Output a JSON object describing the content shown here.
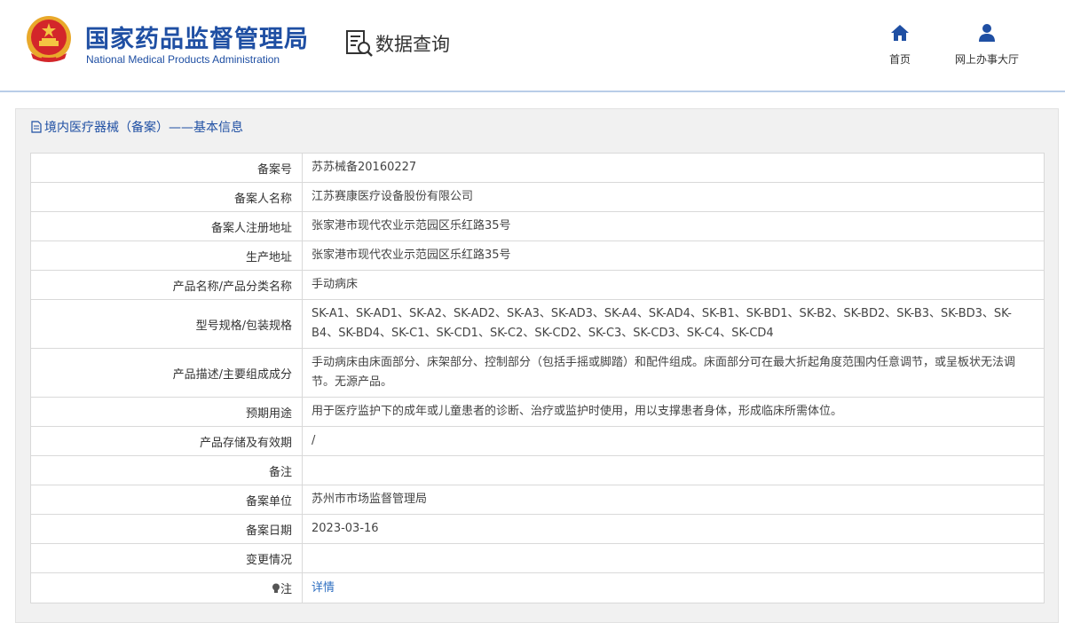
{
  "header": {
    "title_cn": "国家药品监督管理局",
    "title_en": "National Medical Products Administration",
    "query_label": "数据查询",
    "nav": {
      "home": "首页",
      "online_hall": "网上办事大厅"
    }
  },
  "section": {
    "title": "境内医疗器械（备案）——基本信息"
  },
  "rows": [
    {
      "label": "备案号",
      "value": "苏苏械备20160227"
    },
    {
      "label": "备案人名称",
      "value": "江苏赛康医疗设备股份有限公司"
    },
    {
      "label": "备案人注册地址",
      "value": "张家港市现代农业示范园区乐红路35号"
    },
    {
      "label": "生产地址",
      "value": "张家港市现代农业示范园区乐红路35号"
    },
    {
      "label": "产品名称/产品分类名称",
      "value": "手动病床"
    },
    {
      "label": "型号规格/包装规格",
      "value": "SK-A1、SK-AD1、SK-A2、SK-AD2、SK-A3、SK-AD3、SK-A4、SK-AD4、SK-B1、SK-BD1、SK-B2、SK-BD2、SK-B3、SK-BD3、SK-B4、SK-BD4、SK-C1、SK-CD1、SK-C2、SK-CD2、SK-C3、SK-CD3、SK-C4、SK-CD4"
    },
    {
      "label": "产品描述/主要组成成分",
      "value": "手动病床由床面部分、床架部分、控制部分（包括手摇或脚踏）和配件组成。床面部分可在最大折起角度范围内任意调节，或呈板状无法调节。无源产品。"
    },
    {
      "label": "预期用途",
      "value": "用于医疗监护下的成年或儿童患者的诊断、治疗或监护时使用，用以支撑患者身体，形成临床所需体位。"
    },
    {
      "label": "产品存储及有效期",
      "value": "/"
    },
    {
      "label": "备注",
      "value": ""
    },
    {
      "label": "备案单位",
      "value": "苏州市市场监督管理局"
    },
    {
      "label": "备案日期",
      "value": "2023-03-16"
    },
    {
      "label": "变更情况",
      "value": ""
    },
    {
      "label": "注",
      "value": "详情"
    }
  ],
  "colors": {
    "brand_blue": "#1f4fa3",
    "link_blue": "#2f6fc1",
    "panel_bg": "#f1f1f1"
  },
  "icons": [
    "national-emblem-icon",
    "data-query-icon",
    "home-icon",
    "user-icon",
    "document-icon",
    "lightbulb-icon"
  ]
}
